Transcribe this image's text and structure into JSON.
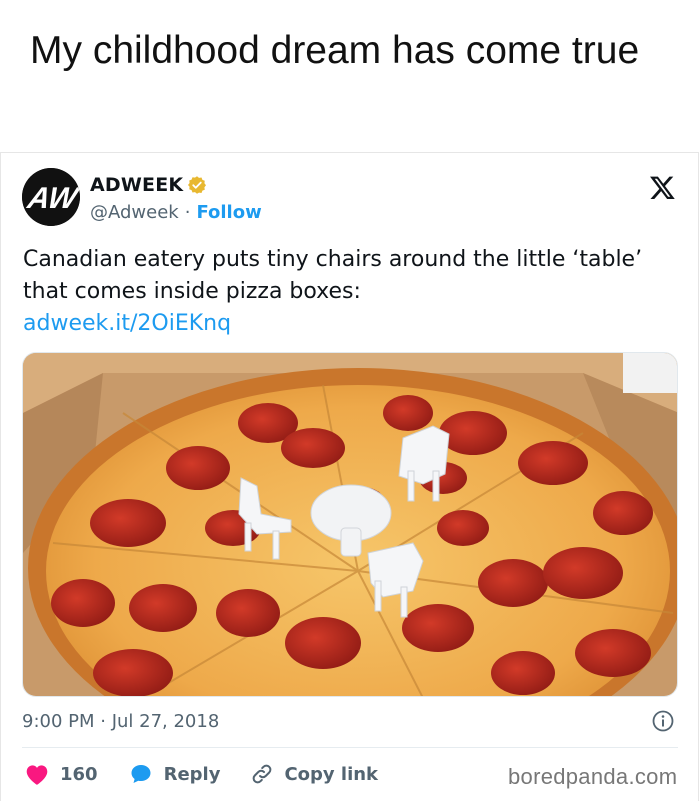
{
  "headline": "My childhood dream has come true",
  "tweet": {
    "author_name": "ADWEEK",
    "author_handle": "@Adweek",
    "separator": "·",
    "follow_label": "Follow",
    "avatar_text": "AW",
    "text": "Canadian eatery puts tiny chairs around the little ‘table’ that comes inside pizza boxes:",
    "link": "adweek.it/2OiEKnq",
    "timestamp": "9:00 PM · Jul 27, 2018",
    "likes": "160",
    "reply_label": "Reply",
    "copy_link_label": "Copy link"
  },
  "watermark": "boredpanda.com",
  "colors": {
    "accent": "#1d9bf0",
    "like": "#f91880",
    "verified": "#e8b830",
    "muted": "#536471"
  },
  "icons": {
    "verified": "verified-badge-icon",
    "platform": "x-logo-icon",
    "info": "info-icon",
    "like": "heart-icon",
    "reply": "speech-bubble-icon",
    "copy": "link-icon"
  }
}
